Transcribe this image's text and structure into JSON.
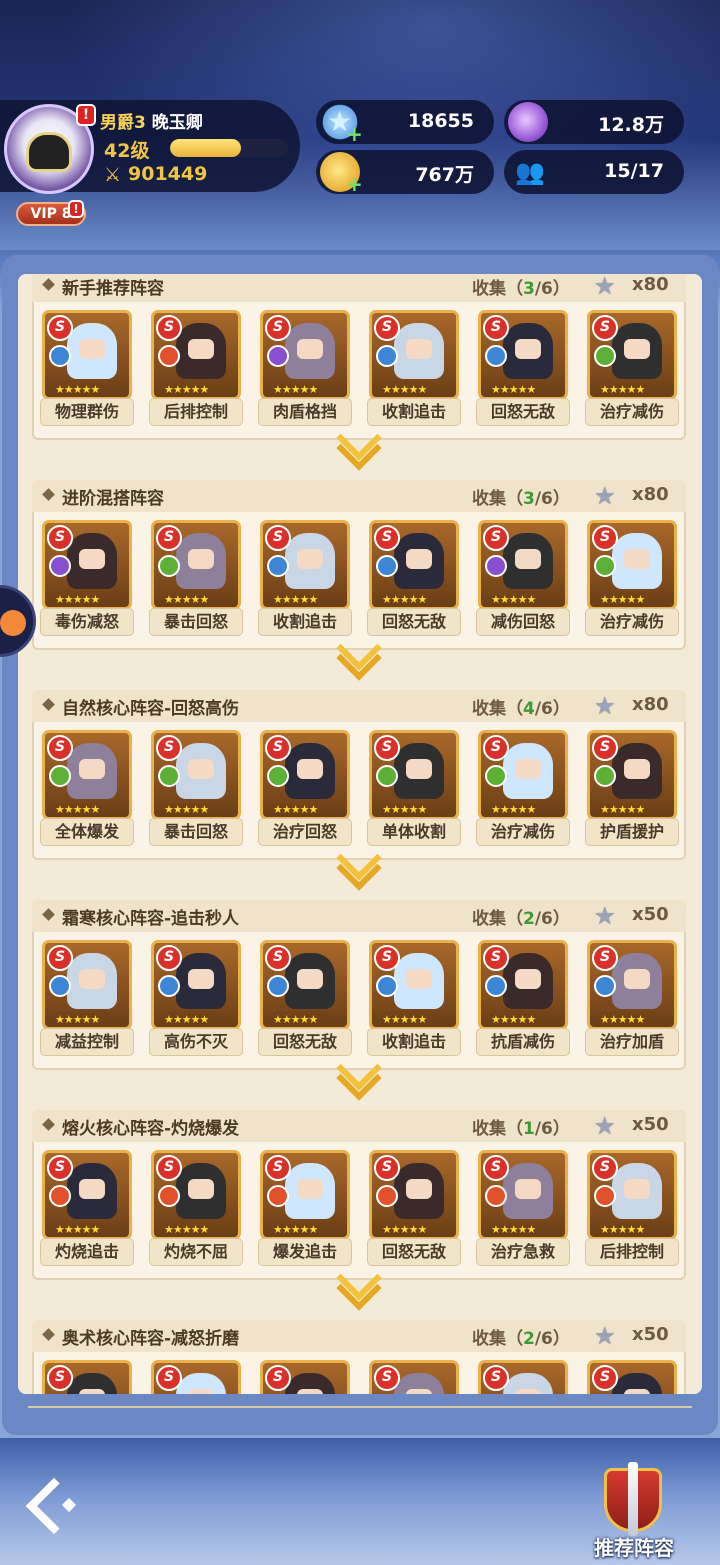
{
  "player": {
    "rank": "男爵3",
    "name": "晚玉卿",
    "level": "42级",
    "exp_fraction": 0.6,
    "power": "901449",
    "vip": "VIP 8"
  },
  "resources": {
    "stars": "18655",
    "purple": "12.8万",
    "gold": "767万",
    "members": "15/17"
  },
  "colors": {
    "accent_gold": "#f0c545",
    "collect_green": "#3e9a36",
    "panel_bg": "#f4ead8"
  },
  "groups": [
    {
      "title": "新手推荐阵容",
      "collect_label": "收集（",
      "collect_num": "3",
      "collect_total": "/6）",
      "reward": "x80",
      "heroes": [
        {
          "tag": "物理群伤",
          "element": "frost"
        },
        {
          "tag": "后排控制",
          "element": "fire"
        },
        {
          "tag": "肉盾格挡",
          "element": "arcane"
        },
        {
          "tag": "收割追击",
          "element": "frost"
        },
        {
          "tag": "回怒无敌",
          "element": "frost"
        },
        {
          "tag": "治疗减伤",
          "element": "nature"
        }
      ]
    },
    {
      "title": "进阶混搭阵容",
      "collect_label": "收集（",
      "collect_num": "3",
      "collect_total": "/6）",
      "reward": "x80",
      "heroes": [
        {
          "tag": "毒伤减怒",
          "element": "arcane"
        },
        {
          "tag": "暴击回怒",
          "element": "nature"
        },
        {
          "tag": "收割追击",
          "element": "frost"
        },
        {
          "tag": "回怒无敌",
          "element": "frost"
        },
        {
          "tag": "减伤回怒",
          "element": "arcane"
        },
        {
          "tag": "治疗减伤",
          "element": "nature"
        }
      ]
    },
    {
      "title": "自然核心阵容-回怒高伤",
      "collect_label": "收集（",
      "collect_num": "4",
      "collect_total": "/6）",
      "reward": "x80",
      "heroes": [
        {
          "tag": "全体爆发",
          "element": "nature"
        },
        {
          "tag": "暴击回怒",
          "element": "nature"
        },
        {
          "tag": "治疗回怒",
          "element": "nature"
        },
        {
          "tag": "单体收割",
          "element": "nature"
        },
        {
          "tag": "治疗减伤",
          "element": "nature"
        },
        {
          "tag": "护盾援护",
          "element": "nature"
        }
      ]
    },
    {
      "title": "霜寒核心阵容-追击秒人",
      "collect_label": "收集（",
      "collect_num": "2",
      "collect_total": "/6）",
      "reward": "x50",
      "heroes": [
        {
          "tag": "减益控制",
          "element": "frost"
        },
        {
          "tag": "高伤不灭",
          "element": "frost"
        },
        {
          "tag": "回怒无敌",
          "element": "frost"
        },
        {
          "tag": "收割追击",
          "element": "frost"
        },
        {
          "tag": "抗盾减伤",
          "element": "frost"
        },
        {
          "tag": "治疗加盾",
          "element": "frost"
        }
      ]
    },
    {
      "title": "熔火核心阵容-灼烧爆发",
      "collect_label": "收集（",
      "collect_num": "1",
      "collect_total": "/6）",
      "reward": "x50",
      "heroes": [
        {
          "tag": "灼烧追击",
          "element": "fire"
        },
        {
          "tag": "灼烧不屈",
          "element": "fire"
        },
        {
          "tag": "爆发追击",
          "element": "fire"
        },
        {
          "tag": "回怒无敌",
          "element": "fire"
        },
        {
          "tag": "治疗急救",
          "element": "fire"
        },
        {
          "tag": "后排控制",
          "element": "fire"
        }
      ]
    },
    {
      "title": "奥术核心阵容-减怒折磨",
      "collect_label": "收集（",
      "collect_num": "2",
      "collect_total": "/6）",
      "reward": "x50",
      "heroes": [
        {
          "tag": "",
          "element": "arcane"
        },
        {
          "tag": "",
          "element": "arcane"
        },
        {
          "tag": "",
          "element": "arcane"
        },
        {
          "tag": "",
          "element": "arcane"
        },
        {
          "tag": "",
          "element": "arcane"
        },
        {
          "tag": "",
          "element": "arcane"
        }
      ]
    }
  ],
  "footer": {
    "recommend_label": "推荐阵容"
  }
}
